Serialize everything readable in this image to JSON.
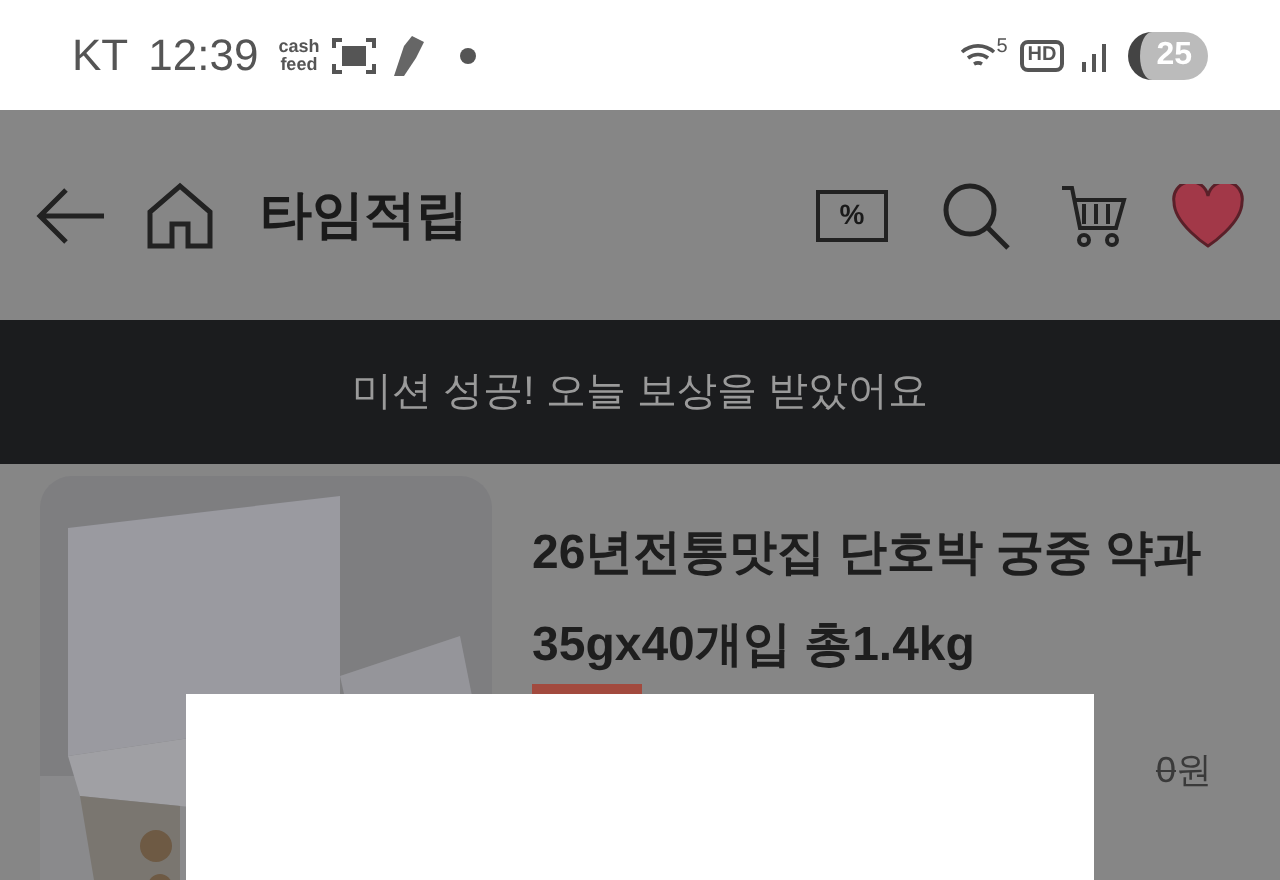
{
  "status_bar": {
    "carrier": "KT",
    "time": "12:39",
    "app_badge": [
      "cash",
      "feed"
    ],
    "wifi_band": "5",
    "hd_label": "HD",
    "battery": "25"
  },
  "header": {
    "title": "타임적립",
    "coupon_label": "%"
  },
  "banner": {
    "text": "미션 성공! 오늘 보상을 받았어요"
  },
  "product": {
    "title": "26년전통맛집 단호박 궁중 약과 35gx40개입 총1.4kg",
    "original_price": "0",
    "currency": "원"
  }
}
